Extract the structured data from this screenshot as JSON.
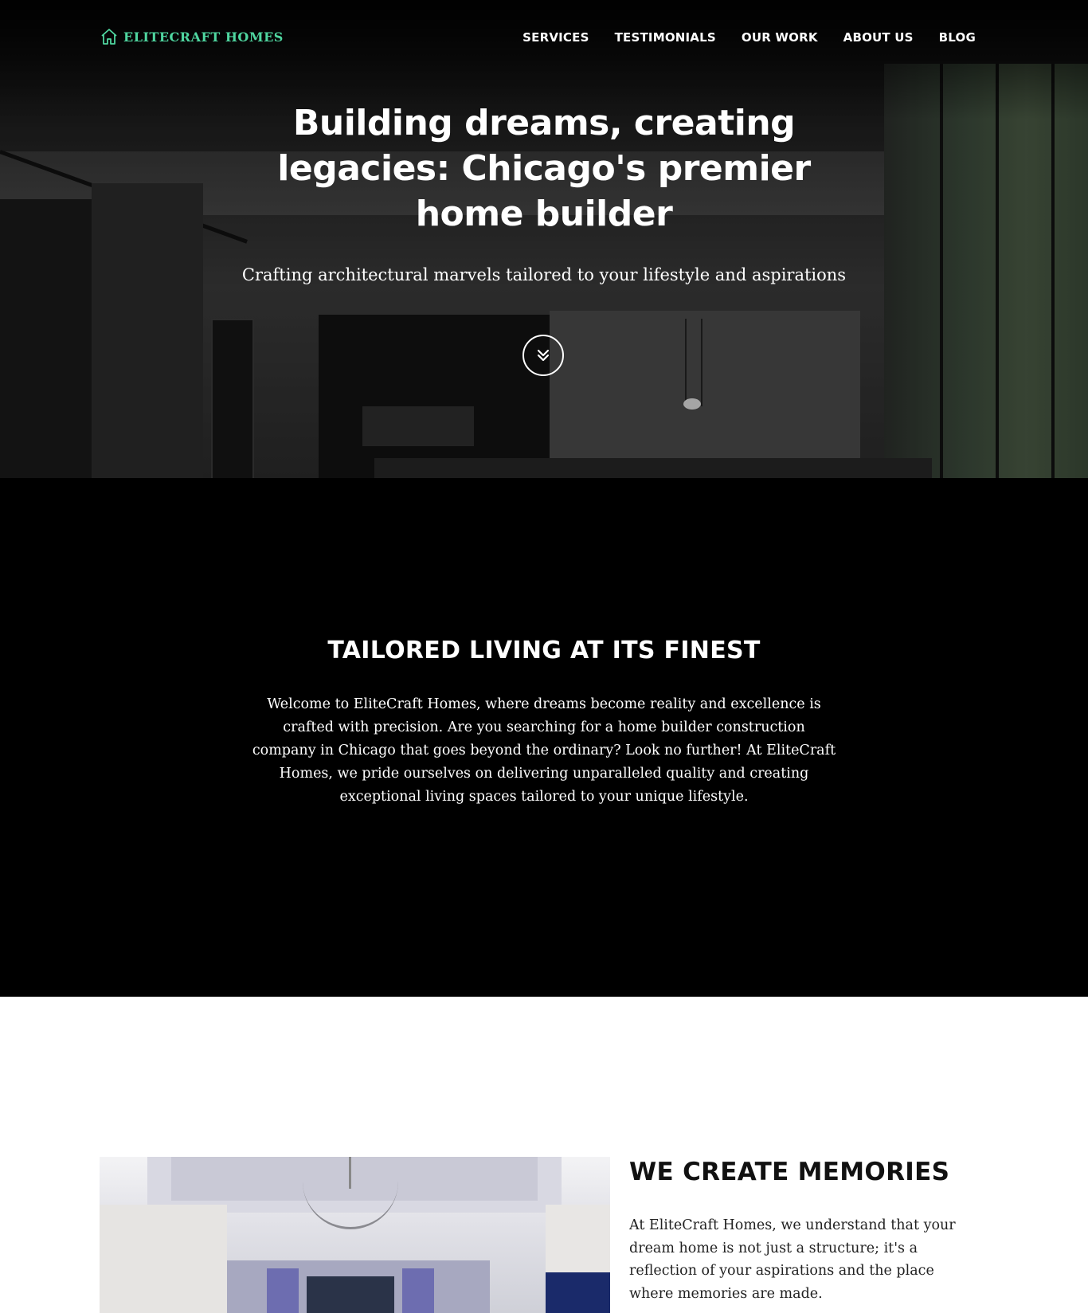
{
  "brand": {
    "name": "ELITECRAFT HOMES",
    "accent": "#4fd6a0"
  },
  "nav": {
    "items": [
      "SERVICES",
      "TESTIMONIALS",
      "OUR WORK",
      "ABOUT US",
      "BLOG"
    ]
  },
  "hero": {
    "title": "Building dreams, creating legacies: Chicago's premier home builder",
    "subtitle": "Crafting architectural marvels tailored to your lifestyle and aspirations",
    "scroll_icon": "double-chevron-down-icon"
  },
  "intro": {
    "heading": "TAILORED LIVING AT ITS FINEST",
    "body": "Welcome to EliteCraft Homes, where dreams become reality and excellence is crafted with precision. Are you searching for a home builder construction company in Chicago that goes beyond the ordinary? Look no further! At EliteCraft Homes, we pride ourselves on delivering unparalleled quality and creating exceptional living spaces tailored to your unique lifestyle."
  },
  "memories": {
    "heading": "WE CREATE MEMORIES",
    "body": "At EliteCraft Homes, we understand that your dream home is not just a structure; it's a reflection of your aspirations and the place where memories are made."
  }
}
